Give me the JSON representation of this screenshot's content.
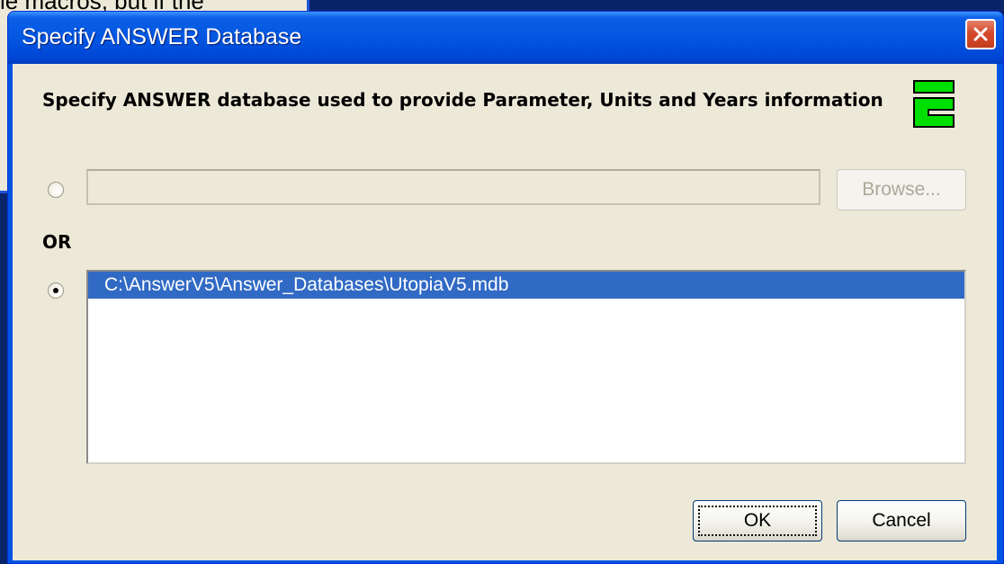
{
  "background_window": {
    "text": "le macros, but if the"
  },
  "dialog": {
    "title": "Specify ANSWER Database",
    "instruction": "Specify ANSWER database used to provide Parameter, Units and Years information",
    "logo_icon": "answer-logo-icon",
    "logo_color": "#00e000",
    "path_input": {
      "value": "",
      "enabled": false
    },
    "browse_label": "Browse...",
    "or_label": "OR",
    "radio_file_selected": false,
    "radio_list_selected": true,
    "database_list": [
      "C:\\AnswerV5\\Answer_Databases\\UtopiaV5.mdb"
    ],
    "selected_index": 0,
    "ok_label": "OK",
    "cancel_label": "Cancel"
  },
  "colors": {
    "titlebar": "#0255e0",
    "client": "#ece9d8",
    "selection": "#316ac5",
    "close_button": "#d54a2c"
  }
}
